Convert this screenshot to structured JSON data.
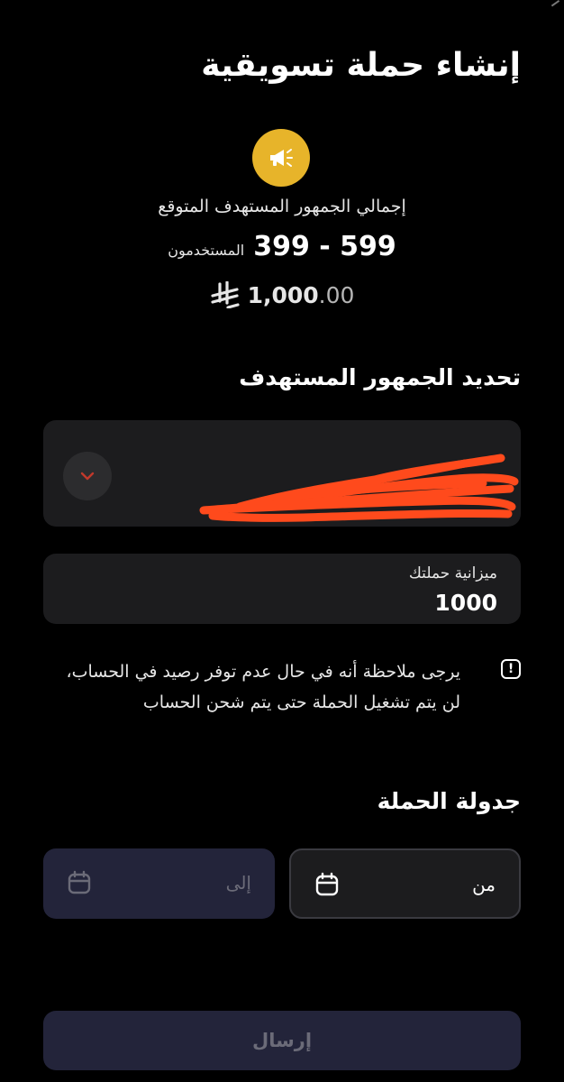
{
  "header": {
    "title": "إنشاء حملة تسويقية"
  },
  "summary": {
    "reach_label": "إجمالي الجمهور المستهدف المتوقع",
    "reach_range": "399 - 599",
    "reach_unit": "المستخدمون",
    "budget_whole": "1,000",
    "budget_decimal": ".00",
    "currency_icon": "riyal-symbol-icon",
    "badge_icon": "megaphone-icon",
    "badge_color": "#e7b42a"
  },
  "audience": {
    "section_title": "تحديد الجمهور المستهدف",
    "dropdown_icon": "chevron-down-icon",
    "chevron_color": "#c0392b"
  },
  "budget": {
    "label": "ميزانية حملتك",
    "value": "1000"
  },
  "notice": {
    "text": "يرجى ملاحظة أنه في حال عدم توفر رصيد في الحساب، لن يتم تشغيل الحملة حتى يتم شحن الحساب",
    "icon": "exclamation-icon"
  },
  "schedule": {
    "section_title": "جدولة الحملة",
    "from_label": "من",
    "to_label": "إلى",
    "calendar_icon": "calendar-icon"
  },
  "actions": {
    "submit_label": "إرسال"
  }
}
